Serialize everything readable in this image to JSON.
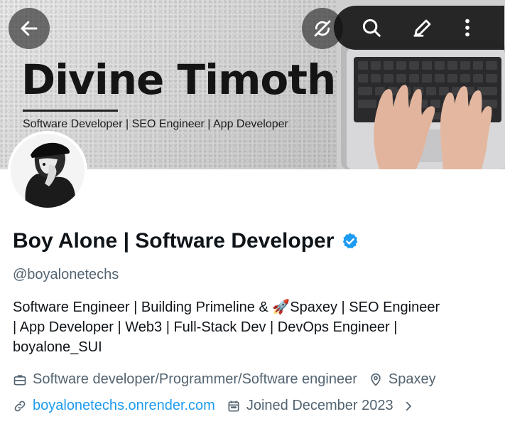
{
  "banner": {
    "name": "Divine Timothy",
    "tagline": "Software Developer | SEO Engineer | App Developer"
  },
  "toolbar": {
    "back": "back-arrow-icon",
    "items": [
      "no-sync-icon",
      "search-icon",
      "edit-icon",
      "more-icon"
    ]
  },
  "profile": {
    "display_name": "Boy Alone | Software Developer",
    "handle": "@boyalonetechs",
    "bio_lines": [
      "Software Engineer | Building  Primeline & 🚀Spaxey  | SEO  Engineer",
      "| App Developer | Web3 | Full-Stack Dev  | DevOps Engineer |",
      "boyalone_SUI"
    ],
    "profession": "Software developer/Programmer/Software engineer",
    "location": "Spaxey",
    "website": "boyalonetechs.onrender.com",
    "joined": "Joined December 2023"
  },
  "colors": {
    "accent": "#1d9bf0",
    "muted": "#536471",
    "text": "#0f1419"
  }
}
